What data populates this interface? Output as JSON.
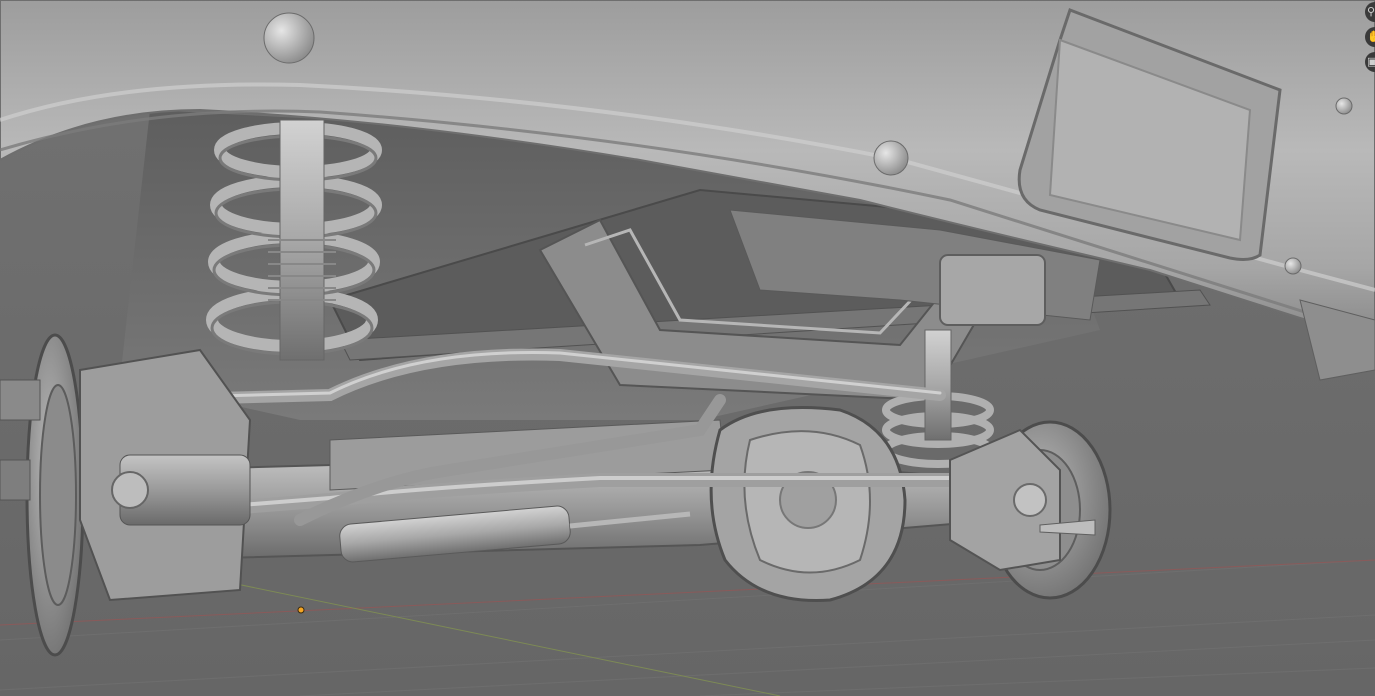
{
  "viewport": {
    "background_color": "#6b6b6b",
    "mesh_color": "#b4b4b4",
    "shading": "solid",
    "axis_x_color": "#8a5a5a",
    "axis_y_color": "#7d8a55",
    "origin_color": "#f5a623"
  },
  "nav_gizmo": {
    "buttons": [
      {
        "icon": "zoom-icon",
        "label": "⚲"
      },
      {
        "icon": "pan-icon",
        "label": "✋"
      },
      {
        "icon": "camera-icon",
        "label": "▣"
      }
    ]
  }
}
